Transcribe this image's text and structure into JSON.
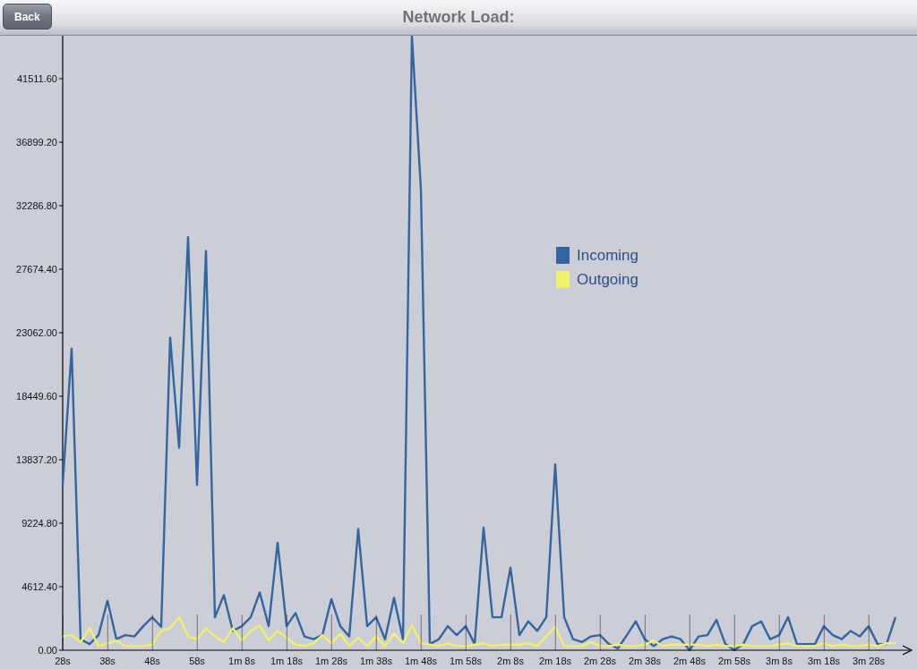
{
  "nav_bar": {
    "back_button": "Back",
    "title": "Network Load:"
  },
  "chart": {
    "chart_data": {
      "type": "line",
      "x": [
        28,
        30,
        32,
        34,
        36,
        38,
        40,
        42,
        44,
        46,
        48,
        50,
        52,
        54,
        56,
        58,
        60,
        62,
        64,
        66,
        68,
        70,
        72,
        74,
        76,
        78,
        80,
        82,
        84,
        86,
        88,
        90,
        92,
        94,
        96,
        98,
        100,
        102,
        104,
        106,
        108,
        110,
        112,
        114,
        116,
        118,
        120,
        122,
        124,
        126,
        128,
        130,
        132,
        134,
        136,
        138,
        140,
        142,
        144,
        146,
        148,
        150,
        152,
        154,
        156,
        158,
        160,
        162,
        164,
        166,
        168,
        170,
        172,
        174,
        176,
        178,
        180,
        182,
        184,
        186,
        188,
        190,
        192,
        194,
        196,
        198,
        200,
        202,
        204,
        206,
        208,
        210,
        212,
        214
      ],
      "series": [
        {
          "name": "Incoming",
          "color": "#34659f",
          "values": [
            12000,
            21900,
            800,
            450,
            1100,
            3600,
            800,
            1100,
            1000,
            1750,
            2400,
            1700,
            22700,
            14700,
            30000,
            12000,
            29000,
            2400,
            4000,
            1400,
            1750,
            2400,
            4200,
            1750,
            7800,
            1750,
            2700,
            1000,
            800,
            1100,
            3700,
            1750,
            1000,
            8800,
            1750,
            2400,
            800,
            3800,
            800,
            44600,
            33500,
            450,
            800,
            1750,
            1100,
            1750,
            450,
            8900,
            2400,
            2400,
            6000,
            1100,
            2100,
            1400,
            2400,
            13500,
            2400,
            800,
            600,
            1000,
            1100,
            450,
            130,
            1100,
            2100,
            800,
            300,
            800,
            1000,
            800,
            0,
            1000,
            1100,
            2200,
            450,
            0,
            450,
            1750,
            2100,
            800,
            1100,
            2400,
            450,
            450,
            450,
            1750,
            1100,
            800,
            1400,
            1000,
            1750,
            450,
            450,
            2400
          ]
        },
        {
          "name": "Outgoing",
          "color": "#f2f26a",
          "values": [
            1000,
            1100,
            600,
            1600,
            300,
            500,
            700,
            300,
            300,
            300,
            400,
            1400,
            1600,
            2400,
            1000,
            800,
            1600,
            1000,
            600,
            1600,
            700,
            1400,
            1800,
            700,
            1400,
            900,
            400,
            300,
            500,
            1100,
            500,
            1200,
            300,
            900,
            300,
            1000,
            300,
            1200,
            500,
            1800,
            500,
            400,
            300,
            500,
            300,
            300,
            400,
            500,
            300,
            400,
            400,
            400,
            500,
            300,
            1000,
            1700,
            300,
            300,
            300,
            600,
            300,
            300,
            400,
            300,
            300,
            400,
            700,
            300,
            400,
            400,
            400,
            400,
            300,
            400,
            300,
            300,
            400,
            300,
            300,
            300,
            400,
            500,
            300,
            300,
            300,
            500,
            300,
            400,
            300,
            300,
            400,
            300,
            500,
            500
          ]
        }
      ],
      "legend": true,
      "xlim": [
        27.1,
        216.7
      ],
      "ylim": [
        0,
        44630
      ],
      "xticks": [
        {
          "value": 28,
          "label": "28s"
        },
        {
          "value": 38,
          "label": "38s"
        },
        {
          "value": 48,
          "label": "48s"
        },
        {
          "value": 58,
          "label": "58s"
        },
        {
          "value": 68,
          "label": "1m 8s"
        },
        {
          "value": 78,
          "label": "1m 18s"
        },
        {
          "value": 88,
          "label": "1m 28s"
        },
        {
          "value": 98,
          "label": "1m 38s"
        },
        {
          "value": 108,
          "label": "1m 48s"
        },
        {
          "value": 118,
          "label": "1m 58s"
        },
        {
          "value": 128,
          "label": "2m 8s"
        },
        {
          "value": 138,
          "label": "2m 18s"
        },
        {
          "value": 148,
          "label": "2m 28s"
        },
        {
          "value": 158,
          "label": "2m 38s"
        },
        {
          "value": 168,
          "label": "2m 48s"
        },
        {
          "value": 178,
          "label": "2m 58s"
        },
        {
          "value": 188,
          "label": "3m 8s"
        },
        {
          "value": 198,
          "label": "3m 18s"
        },
        {
          "value": 208,
          "label": "3m 28s"
        }
      ],
      "yticks": [
        {
          "value": 0,
          "label": "0.00"
        },
        {
          "value": 4612.4,
          "label": "4612.40"
        },
        {
          "value": 9224.8,
          "label": "9224.80"
        },
        {
          "value": 13837.2,
          "label": "13837.20"
        },
        {
          "value": 18449.6,
          "label": "18449.60"
        },
        {
          "value": 23062,
          "label": "23062.00"
        },
        {
          "value": 27674.4,
          "label": "27674.40"
        },
        {
          "value": 32286.8,
          "label": "32286.80"
        },
        {
          "value": 36899.2,
          "label": "36899.20"
        },
        {
          "value": 41511.6,
          "label": "41511.60"
        }
      ]
    }
  }
}
